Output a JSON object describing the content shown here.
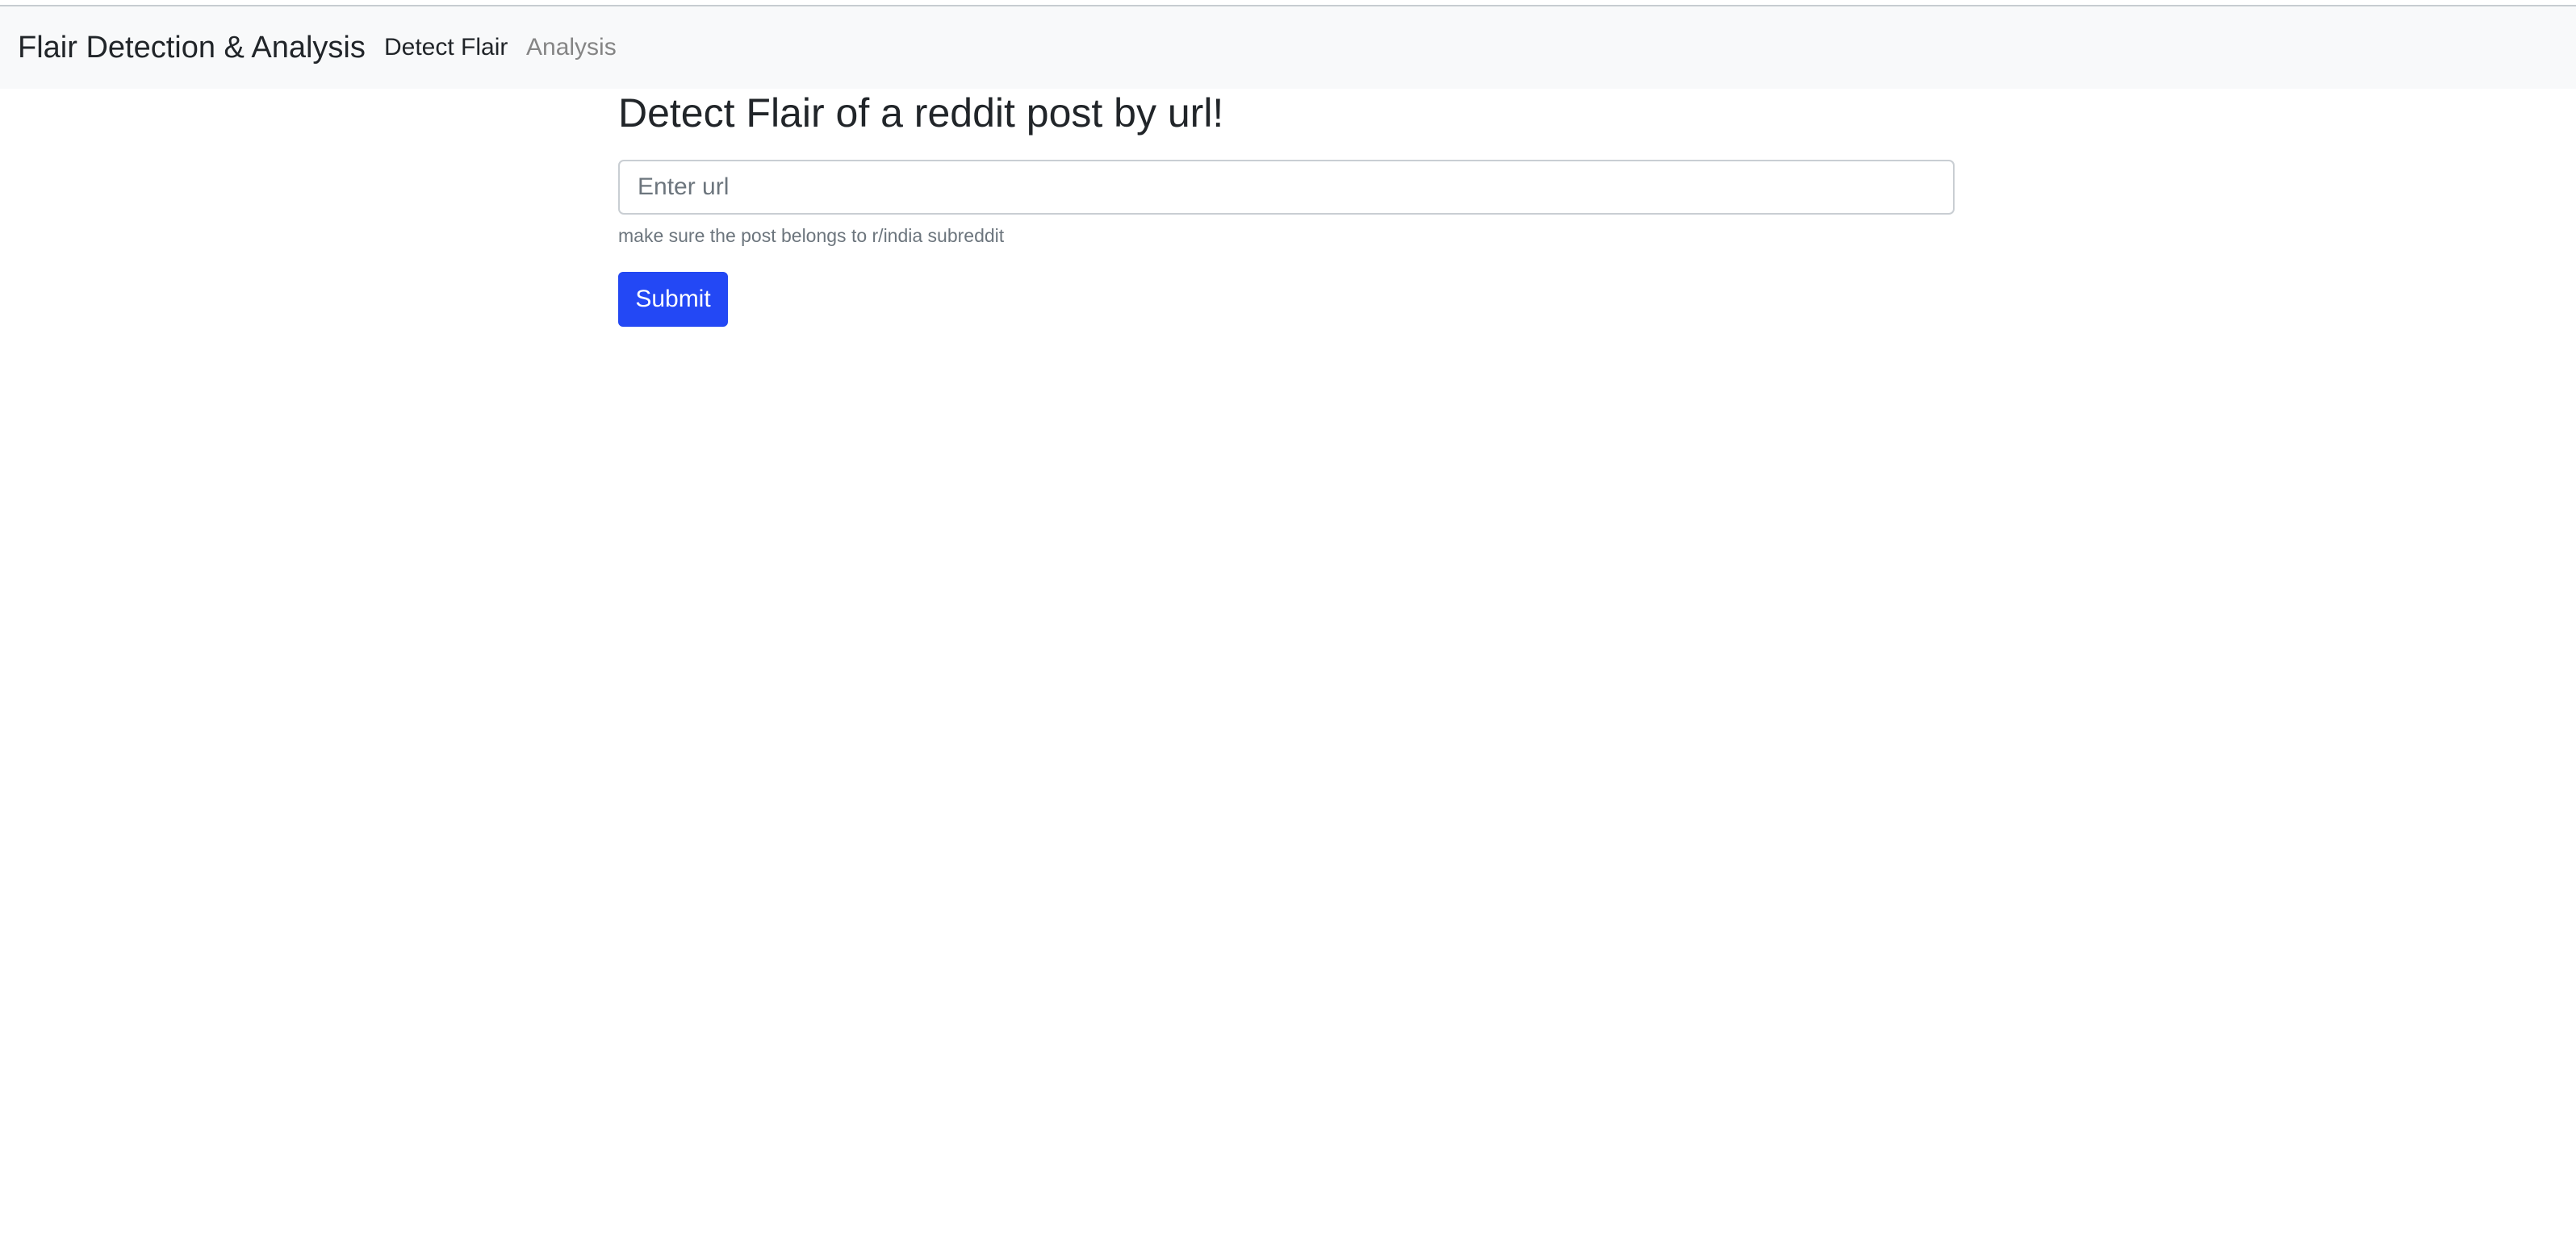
{
  "navbar": {
    "brand": "Flair Detection & Analysis",
    "links": [
      {
        "label": "Detect Flair",
        "active": true
      },
      {
        "label": "Analysis",
        "active": false
      }
    ]
  },
  "main": {
    "title": "Detect Flair of a reddit post by url!",
    "url_input": {
      "placeholder": "Enter url",
      "value": ""
    },
    "help_text": "make sure the post belongs to r/india subreddit",
    "submit_label": "Submit"
  },
  "colors": {
    "navbar_bg": "#f8f9fa",
    "primary": "#2348f5",
    "muted_text": "#6c757d"
  }
}
